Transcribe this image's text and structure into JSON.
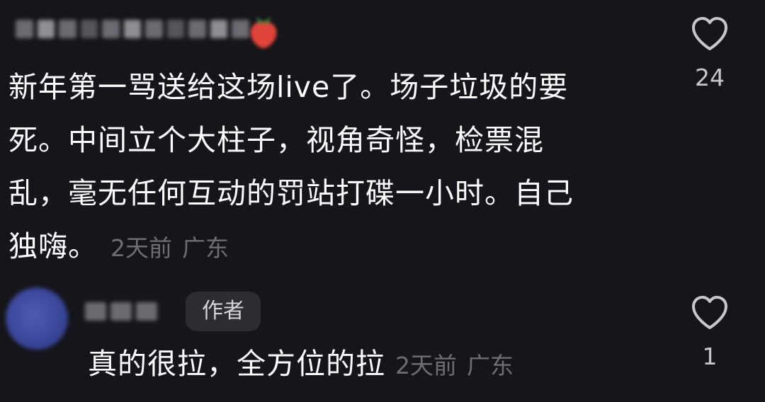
{
  "comments": [
    {
      "text_lines": [
        "新年第一骂送给这场live了。场子垃圾的要",
        "死。中间立个大柱子，视角奇怪，检票混",
        "乱，毫无任何互动的罚站打碟一小时。自己",
        "独嗨。"
      ],
      "time": "2天前",
      "location": "广东",
      "likes": "24"
    }
  ],
  "reply": {
    "badge": "作者",
    "text": "真的很拉，全方位的拉",
    "time": "2天前",
    "location": "广东",
    "likes": "1"
  },
  "colors": {
    "background": "#16151b",
    "text": "#ffffff",
    "meta": "#6e6d74",
    "badge_bg": "#2d2c33"
  },
  "icons": {
    "like": "heart-outline-icon",
    "emoji": "strawberry-icon"
  }
}
